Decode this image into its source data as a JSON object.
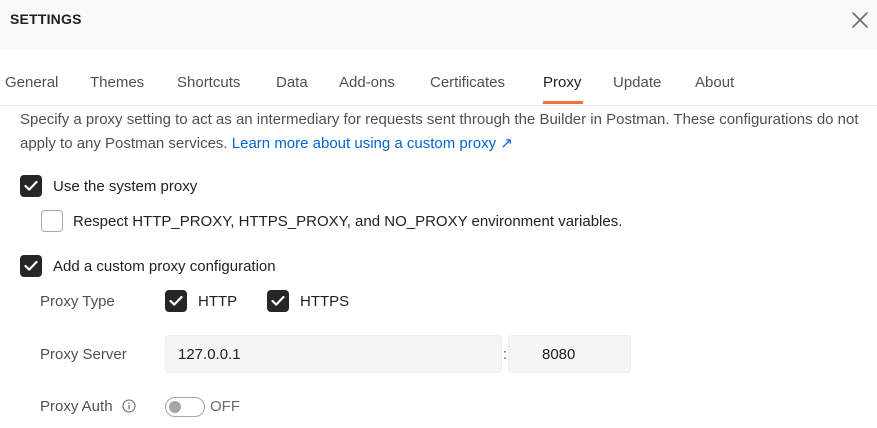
{
  "header": {
    "title": "SETTINGS",
    "close_icon": "close-icon"
  },
  "tabs": [
    {
      "label": "General"
    },
    {
      "label": "Themes"
    },
    {
      "label": "Shortcuts"
    },
    {
      "label": "Data"
    },
    {
      "label": "Add-ons"
    },
    {
      "label": "Certificates"
    },
    {
      "label": "Proxy",
      "active": true
    },
    {
      "label": "Update"
    },
    {
      "label": "About"
    }
  ],
  "proxy": {
    "description": "Specify a proxy setting to act as an intermediary for requests sent through the Builder in Postman. These configurations do not apply to any Postman services.",
    "learn_more_link": "Learn more about using a custom proxy ↗",
    "use_system_proxy": {
      "label": "Use the system proxy",
      "checked": true
    },
    "respect_env": {
      "label": "Respect HTTP_PROXY, HTTPS_PROXY, and NO_PROXY environment variables.",
      "checked": false
    },
    "custom_proxy": {
      "label": "Add a custom proxy configuration",
      "checked": true
    },
    "proxy_type": {
      "label": "Proxy Type",
      "http": {
        "label": "HTTP",
        "checked": true
      },
      "https": {
        "label": "HTTPS",
        "checked": true
      }
    },
    "proxy_server": {
      "label": "Proxy Server",
      "host": "127.0.0.1",
      "separator": ":",
      "port": "8080"
    },
    "proxy_auth": {
      "label": "Proxy Auth",
      "info_icon": "info-icon",
      "toggle_state": "OFF",
      "enabled": false
    }
  },
  "colors": {
    "accent": "#ff6c37",
    "link": "#0265d2",
    "checkbox": "#262626"
  }
}
